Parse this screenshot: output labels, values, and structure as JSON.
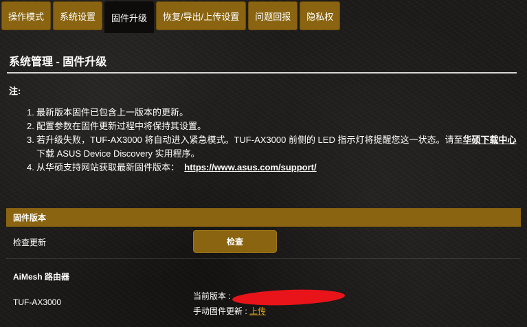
{
  "tabs": [
    {
      "label": "操作模式",
      "active": false
    },
    {
      "label": "系统设置",
      "active": false
    },
    {
      "label": "固件升级",
      "active": true
    },
    {
      "label": "恢复/导出/上传设置",
      "active": false
    },
    {
      "label": "问题回报",
      "active": false
    },
    {
      "label": "隐私权",
      "active": false
    }
  ],
  "page": {
    "title": "系统管理 - 固件升级",
    "note_label": "注:"
  },
  "notes": [
    {
      "num": "1.",
      "text": "最新版本固件已包含上一版本的更新。"
    },
    {
      "num": "2.",
      "text": "配置参数在固件更新过程中将保持其设置。"
    },
    {
      "num": "3.",
      "text_before": "若升级失败，TUF-AX3000 将自动进入紧急模式。TUF-AX3000 前侧的 LED 指示灯将提醒您这一状态。请至",
      "link": "华硕下载中心",
      "text_after": "下载 ASUS Device Discovery 实用程序。"
    },
    {
      "num": "4.",
      "text_before": "从华硕支持网站获取最新固件版本：",
      "link": "https://www.asus.com/support/"
    }
  ],
  "firmware": {
    "section_title": "固件版本",
    "check_update_label": "检查更新",
    "check_button": "检查",
    "aimesh_label": "AiMesh 路由器",
    "device_name": "TUF-AX3000",
    "current_version_label": "当前版本 : ",
    "manual_upgrade_label": "手动固件更新 : ",
    "upload_link": "上传"
  },
  "colors": {
    "accent": "#8a6410",
    "active_tab": "#0d0c0b",
    "link_gold": "#e0a81a",
    "redaction": "#e8141a"
  }
}
